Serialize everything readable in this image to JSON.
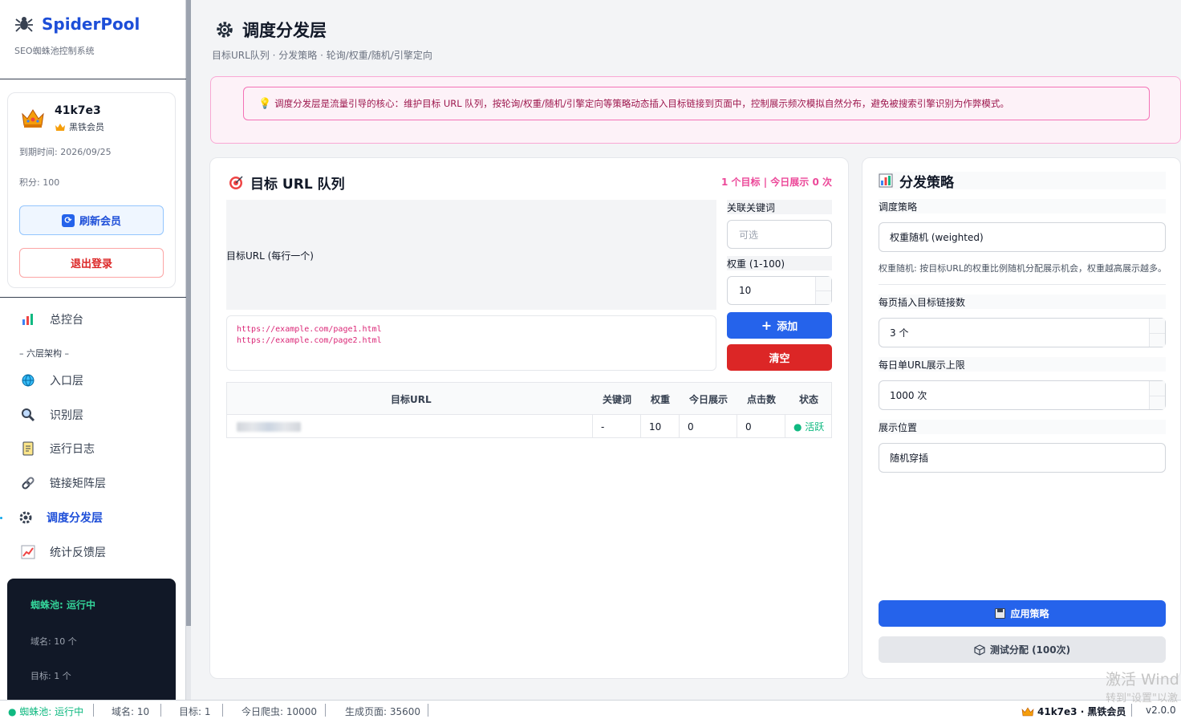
{
  "brand": {
    "title": "SpiderPool",
    "subtitle": "SEO蜘蛛池控制系统"
  },
  "user": {
    "name": "41k7e3",
    "rank": "黑铁会员",
    "expire": "到期时间: 2026/09/25",
    "points": "积分: 100",
    "refresh_label": "刷新会员",
    "logout_label": "退出登录"
  },
  "nav": {
    "dashboard": "总控台",
    "section": "– 六层架构 –",
    "items": [
      "入口层",
      "识别层",
      "运行日志",
      "链接矩阵层",
      "调度分发层",
      "统计反馈层"
    ]
  },
  "status_card": {
    "running": "蜘蛛池: 运行中",
    "domains": "域名: 10 个",
    "targets": "目标: 1 个"
  },
  "header": {
    "title": "调度分发层",
    "subtitle": "目标URL队列 · 分发策略 · 轮询/权重/随机/引擎定向"
  },
  "alert": "调度分发层是流量引导的核心：维护目标 URL 队列，按轮询/权重/随机/引擎定向等策略动态插入目标链接到页面中，控制展示频次模拟自然分布，避免被搜索引擎识别为作弊模式。",
  "queue": {
    "title": "目标 URL 队列",
    "stats": "1 个目标 | 今日展示 0 次",
    "textarea_label": "目标URL (每行一个)",
    "textarea_placeholder": "https://example.com/page1.html\nhttps://example.com/page2.html",
    "keyword_label": "关联关键词",
    "keyword_placeholder": "可选",
    "weight_label": "权重 (1-100)",
    "weight_value": "10",
    "add_label": "添加",
    "clear_label": "清空",
    "columns": [
      "目标URL",
      "关键词",
      "权重",
      "今日展示",
      "点击数",
      "状态"
    ],
    "rows": [
      {
        "keyword": "-",
        "weight": "10",
        "today": "0",
        "clicks": "0",
        "status": "● 活跃"
      }
    ]
  },
  "strategy": {
    "title": "分发策略",
    "mode_label": "调度策略",
    "mode_value": "权重随机 (weighted)",
    "mode_desc": "权重随机: 按目标URL的权重比例随机分配展示机会，权重越高展示越多。",
    "links_label": "每页插入目标链接数",
    "links_value": "3 个",
    "limit_label": "每日单URL展示上限",
    "limit_value": "1000 次",
    "position_label": "展示位置",
    "position_value": "随机穿插",
    "apply_label": "应用策略",
    "test_label": "测试分配 (100次)"
  },
  "statusbar": {
    "running": "● 蜘蛛池: 运行中",
    "domains": "域名: 10",
    "targets": "目标: 1",
    "crawls": "今日爬虫: 10000",
    "pages": "生成页面: 35600",
    "user": "41k7e3 · 黑铁会员",
    "version": "v2.0.0"
  },
  "watermark": {
    "line1": "激活 Wind",
    "line2": "转到\"设置\"以激"
  },
  "colors": {
    "primary": "#2563eb",
    "danger": "#dc2626",
    "accent_pink": "#ec4899",
    "success": "#10b981",
    "dark": "#111827"
  }
}
